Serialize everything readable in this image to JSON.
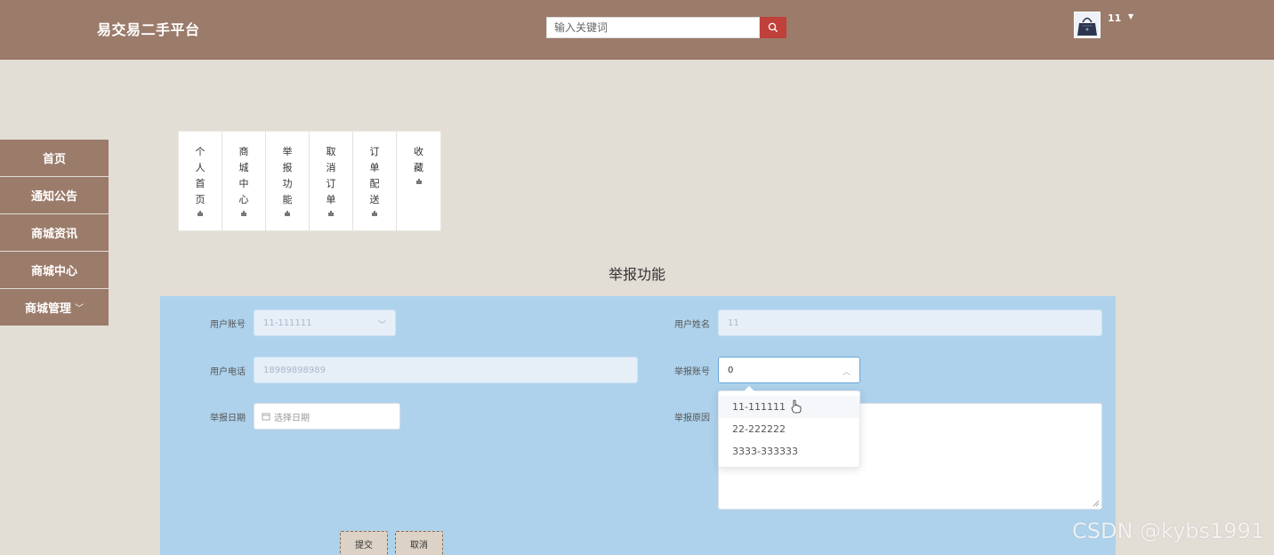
{
  "header": {
    "brand": "易交易二手平台",
    "search_placeholder": "输入关键词",
    "username": "11"
  },
  "sidebar": {
    "items": [
      {
        "label": "首页"
      },
      {
        "label": "通知公告"
      },
      {
        "label": "商城资讯"
      },
      {
        "label": "商城中心"
      },
      {
        "label": "商城管理"
      }
    ]
  },
  "tabs": [
    {
      "label": "个人首页"
    },
    {
      "label": "商城中心"
    },
    {
      "label": "举报功能"
    },
    {
      "label": "取消订单"
    },
    {
      "label": "订单配送"
    },
    {
      "label": "收藏"
    }
  ],
  "page": {
    "title": "举报功能"
  },
  "form": {
    "account_label": "用户账号",
    "account_value": "11-111111",
    "name_label": "用户姓名",
    "name_value": "11",
    "phone_label": "用户电话",
    "phone_value": "18989898989",
    "report_account_label": "举报账号",
    "report_account_value": "0",
    "date_label": "举报日期",
    "date_placeholder": "选择日期",
    "reason_label": "举报原因",
    "options": [
      "11-111111",
      "22-222222",
      "3333-333333"
    ],
    "submit": "提交",
    "cancel": "取消"
  },
  "watermark": "CSDN @kybs1991",
  "colors": {
    "header_bg": "#9b7b6a",
    "page_bg": "#e2ddd5",
    "form_bg": "#aed2ec",
    "search_button": "#c0403a"
  }
}
